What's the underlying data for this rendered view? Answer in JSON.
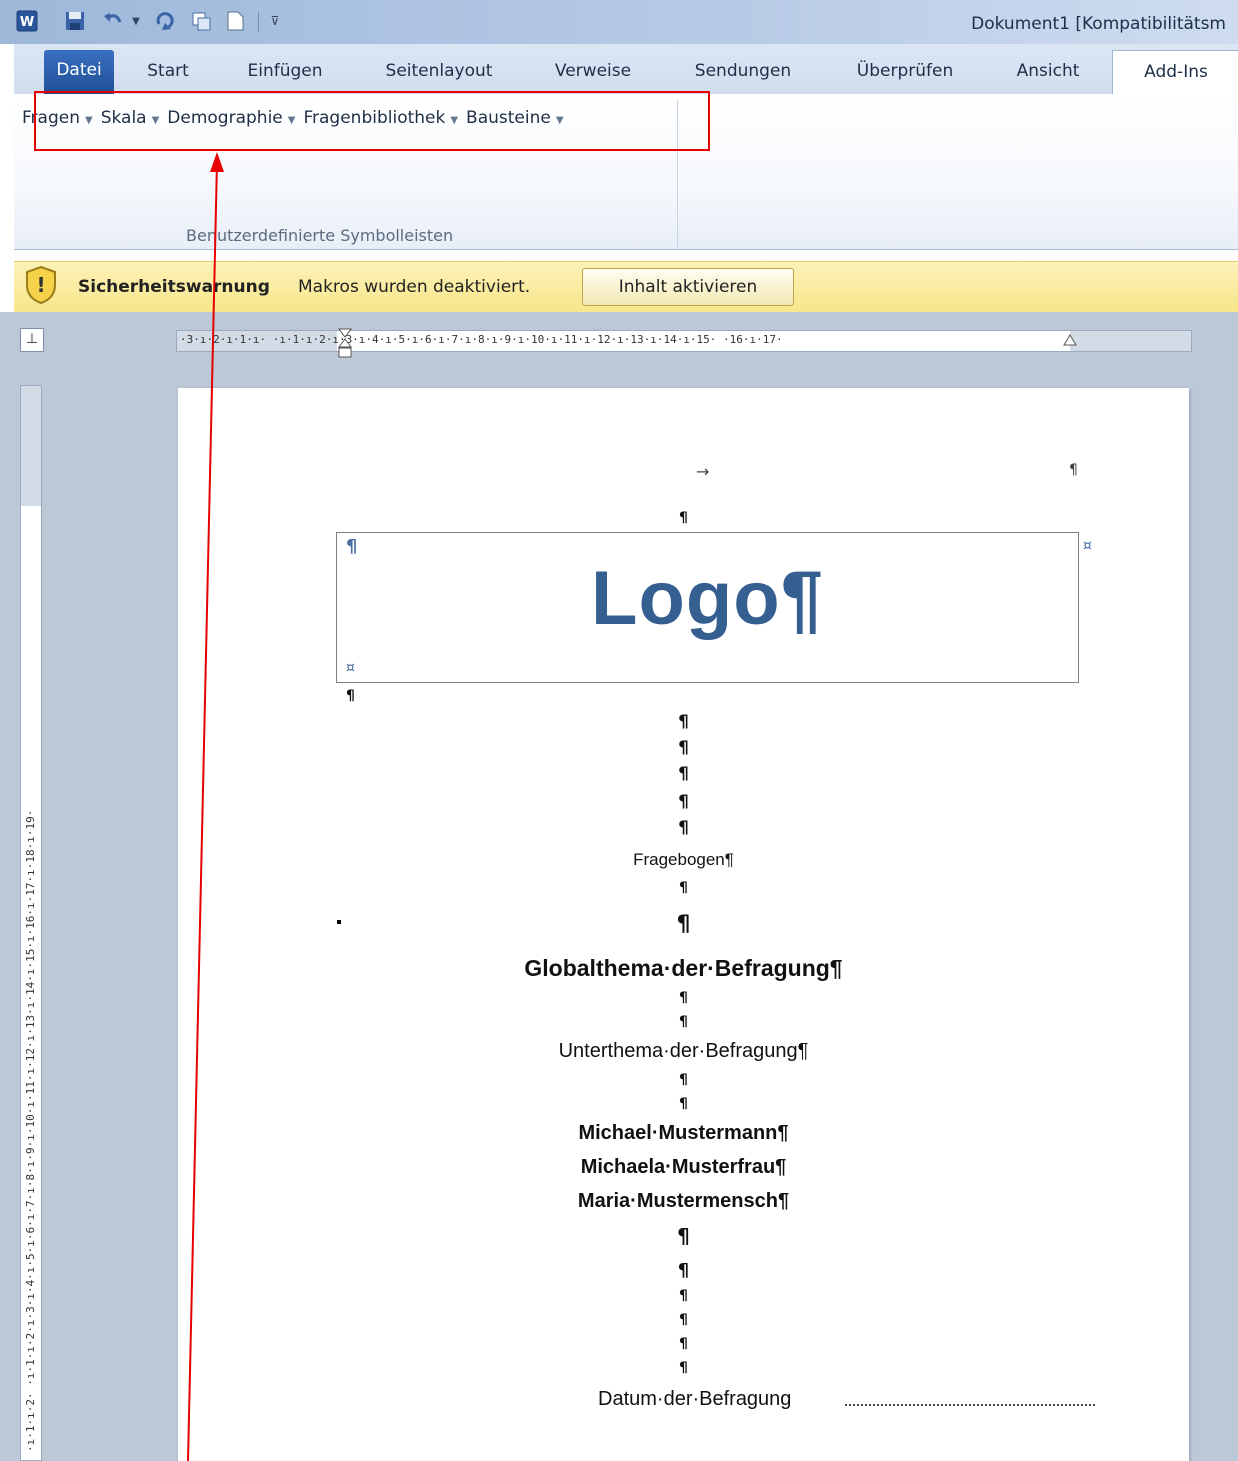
{
  "window": {
    "title": "Dokument1 [Kompatibilitätsm"
  },
  "tabs": [
    "Datei",
    "Start",
    "Einfügen",
    "Seitenlayout",
    "Verweise",
    "Sendungen",
    "Überprüfen",
    "Ansicht",
    "Add-Ins"
  ],
  "ribbon": {
    "dropdowns": [
      "Fragen",
      "Skala",
      "Demographie",
      "Fragenbibliothek",
      "Bausteine"
    ],
    "group_label": "Benutzerdefinierte Symbolleisten"
  },
  "security": {
    "title": "Sicherheitswarnung",
    "message": "Makros wurden deaktiviert.",
    "button": "Inhalt aktivieren"
  },
  "ruler": {
    "horizontal": "·3·ı·2·ı·1·ı· ·ı·1·ı·2·ı·3·ı·4·ı·5·ı·6·ı·7·ı·8·ı·9·ı·10·ı·11·ı·12·ı·13·ı·14·ı·15· ·16·ı·17·",
    "vertical": "·ı·1·ı·2·  ·ı·1·ı·2·ı·3·ı·4·ı·5·ı·6·ı·7·ı·8·ı·9·ı·10·ı·11·ı·12·ı·13·ı·14·ı·15·ı·16·ı·17·ı·18·ı·19·"
  },
  "document": {
    "tab_arrow": "→",
    "pilcrow": "¶",
    "cell_end": "¤",
    "logo": "Logo¶",
    "fragebogen": "Fragebogen¶",
    "global_topic": "Globalthema·der·Befragung¶",
    "sub_topic": "Unterthema·der·Befragung¶",
    "authors": [
      "Michael·Mustermann¶",
      "Michaela·Musterfrau¶",
      "Maria·Mustermensch¶"
    ],
    "date_label": "Datum·der·Befragung"
  },
  "colors": {
    "logo": "#365f91",
    "annotation": "#e60000",
    "security_bar": "#f7e68b"
  }
}
